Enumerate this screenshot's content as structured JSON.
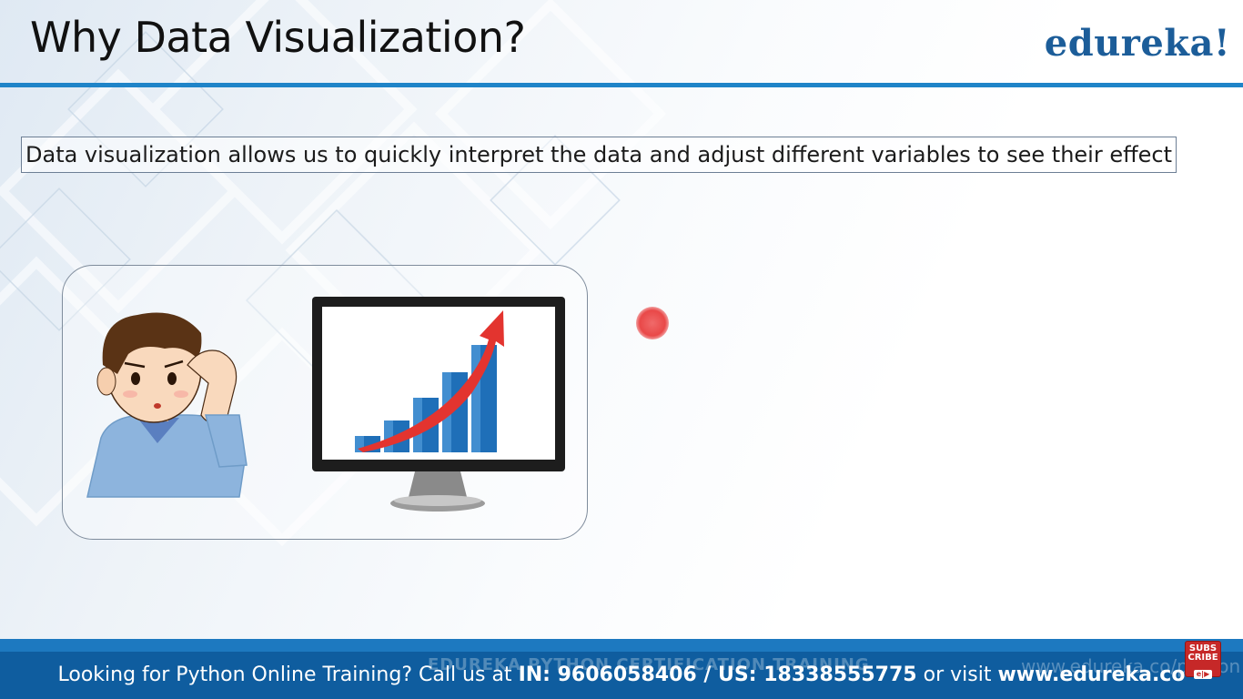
{
  "slide": {
    "title": "Why Data Visualization?",
    "brand": "edureka!",
    "statement": "Data visualization allows us to quickly interpret the data and adjust different variables to see their effect"
  },
  "illustration": {
    "icons": [
      "confused-person-icon",
      "monitor-icon",
      "rising-bar-chart-icon",
      "trend-arrow-icon"
    ],
    "arrow_color": "#e3342f",
    "bar_color": "#1f6fb8"
  },
  "pointer": {
    "color": "#e94848"
  },
  "footer": {
    "ticker_prefix": "Looking for Python Online Training? Call us at",
    "phone_in": "IN: 9606058406 / US: 18338555775",
    "ticker_mid": "or visit",
    "website": "www.edureka.co",
    "watermark_left": "EDUREKA PYTHON CERTIFICATION TRAINING",
    "watermark_right": "www.edureka.co/python"
  },
  "subscribe": {
    "label_top": "SUBS",
    "label_bottom": "CRIBE",
    "badge": "e|▶"
  },
  "colors": {
    "accent": "#1f84c8",
    "brand": "#1c5d99",
    "footer": "#0f5d9f"
  }
}
